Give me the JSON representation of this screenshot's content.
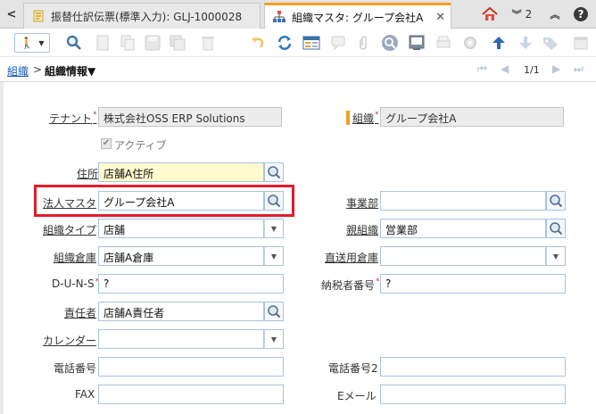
{
  "tabs": [
    {
      "label": "振替仕訳伝票(標準入力): GLJ-1000028",
      "active": false
    },
    {
      "label": "組織マスタ: グループ会社A",
      "active": true
    }
  ],
  "tabbar": {
    "nav_prev": "<",
    "window_count": "2"
  },
  "breadcrumb": {
    "link": "組織",
    "separator": ">",
    "current": "組織情報▼",
    "page_count": "1/1"
  },
  "form": {
    "tenant": {
      "label": "テナント",
      "value": "株式会社OSS ERP Solutions"
    },
    "org": {
      "label": "組織",
      "value": "グループ会社A"
    },
    "active": {
      "label": "アクティブ",
      "checked": true
    },
    "address": {
      "label": "住所",
      "value": "店舗A住所"
    },
    "legal_entity": {
      "label": "法人マスタ",
      "value": "グループ会社A"
    },
    "division": {
      "label": "事業部",
      "value": ""
    },
    "org_type": {
      "label": "組織タイプ",
      "value": "店舗"
    },
    "parent_org": {
      "label": "親組織",
      "value": "営業部"
    },
    "warehouse": {
      "label": "組織倉庫",
      "value": "店舗A倉庫"
    },
    "drop_ship_warehouse": {
      "label": "直送用倉庫",
      "value": ""
    },
    "duns": {
      "label": "D-U-N-S",
      "value": "?"
    },
    "tax_id": {
      "label": "納税者番号",
      "value": "?"
    },
    "supervisor": {
      "label": "責任者",
      "value": "店舗A責任者"
    },
    "calendar": {
      "label": "カレンダー",
      "value": ""
    },
    "phone": {
      "label": "電話番号",
      "value": ""
    },
    "phone2": {
      "label": "電話番号2",
      "value": ""
    },
    "fax": {
      "label": "FAX",
      "value": ""
    },
    "email": {
      "label": "Eメール",
      "value": ""
    }
  },
  "colors": {
    "active_tab_accent": "#f2a11f",
    "highlight_box": "#e31b2c",
    "field_border": "#a9c4e0",
    "mandatory_bg": "#fffbcf",
    "link": "#1a5ab4"
  }
}
